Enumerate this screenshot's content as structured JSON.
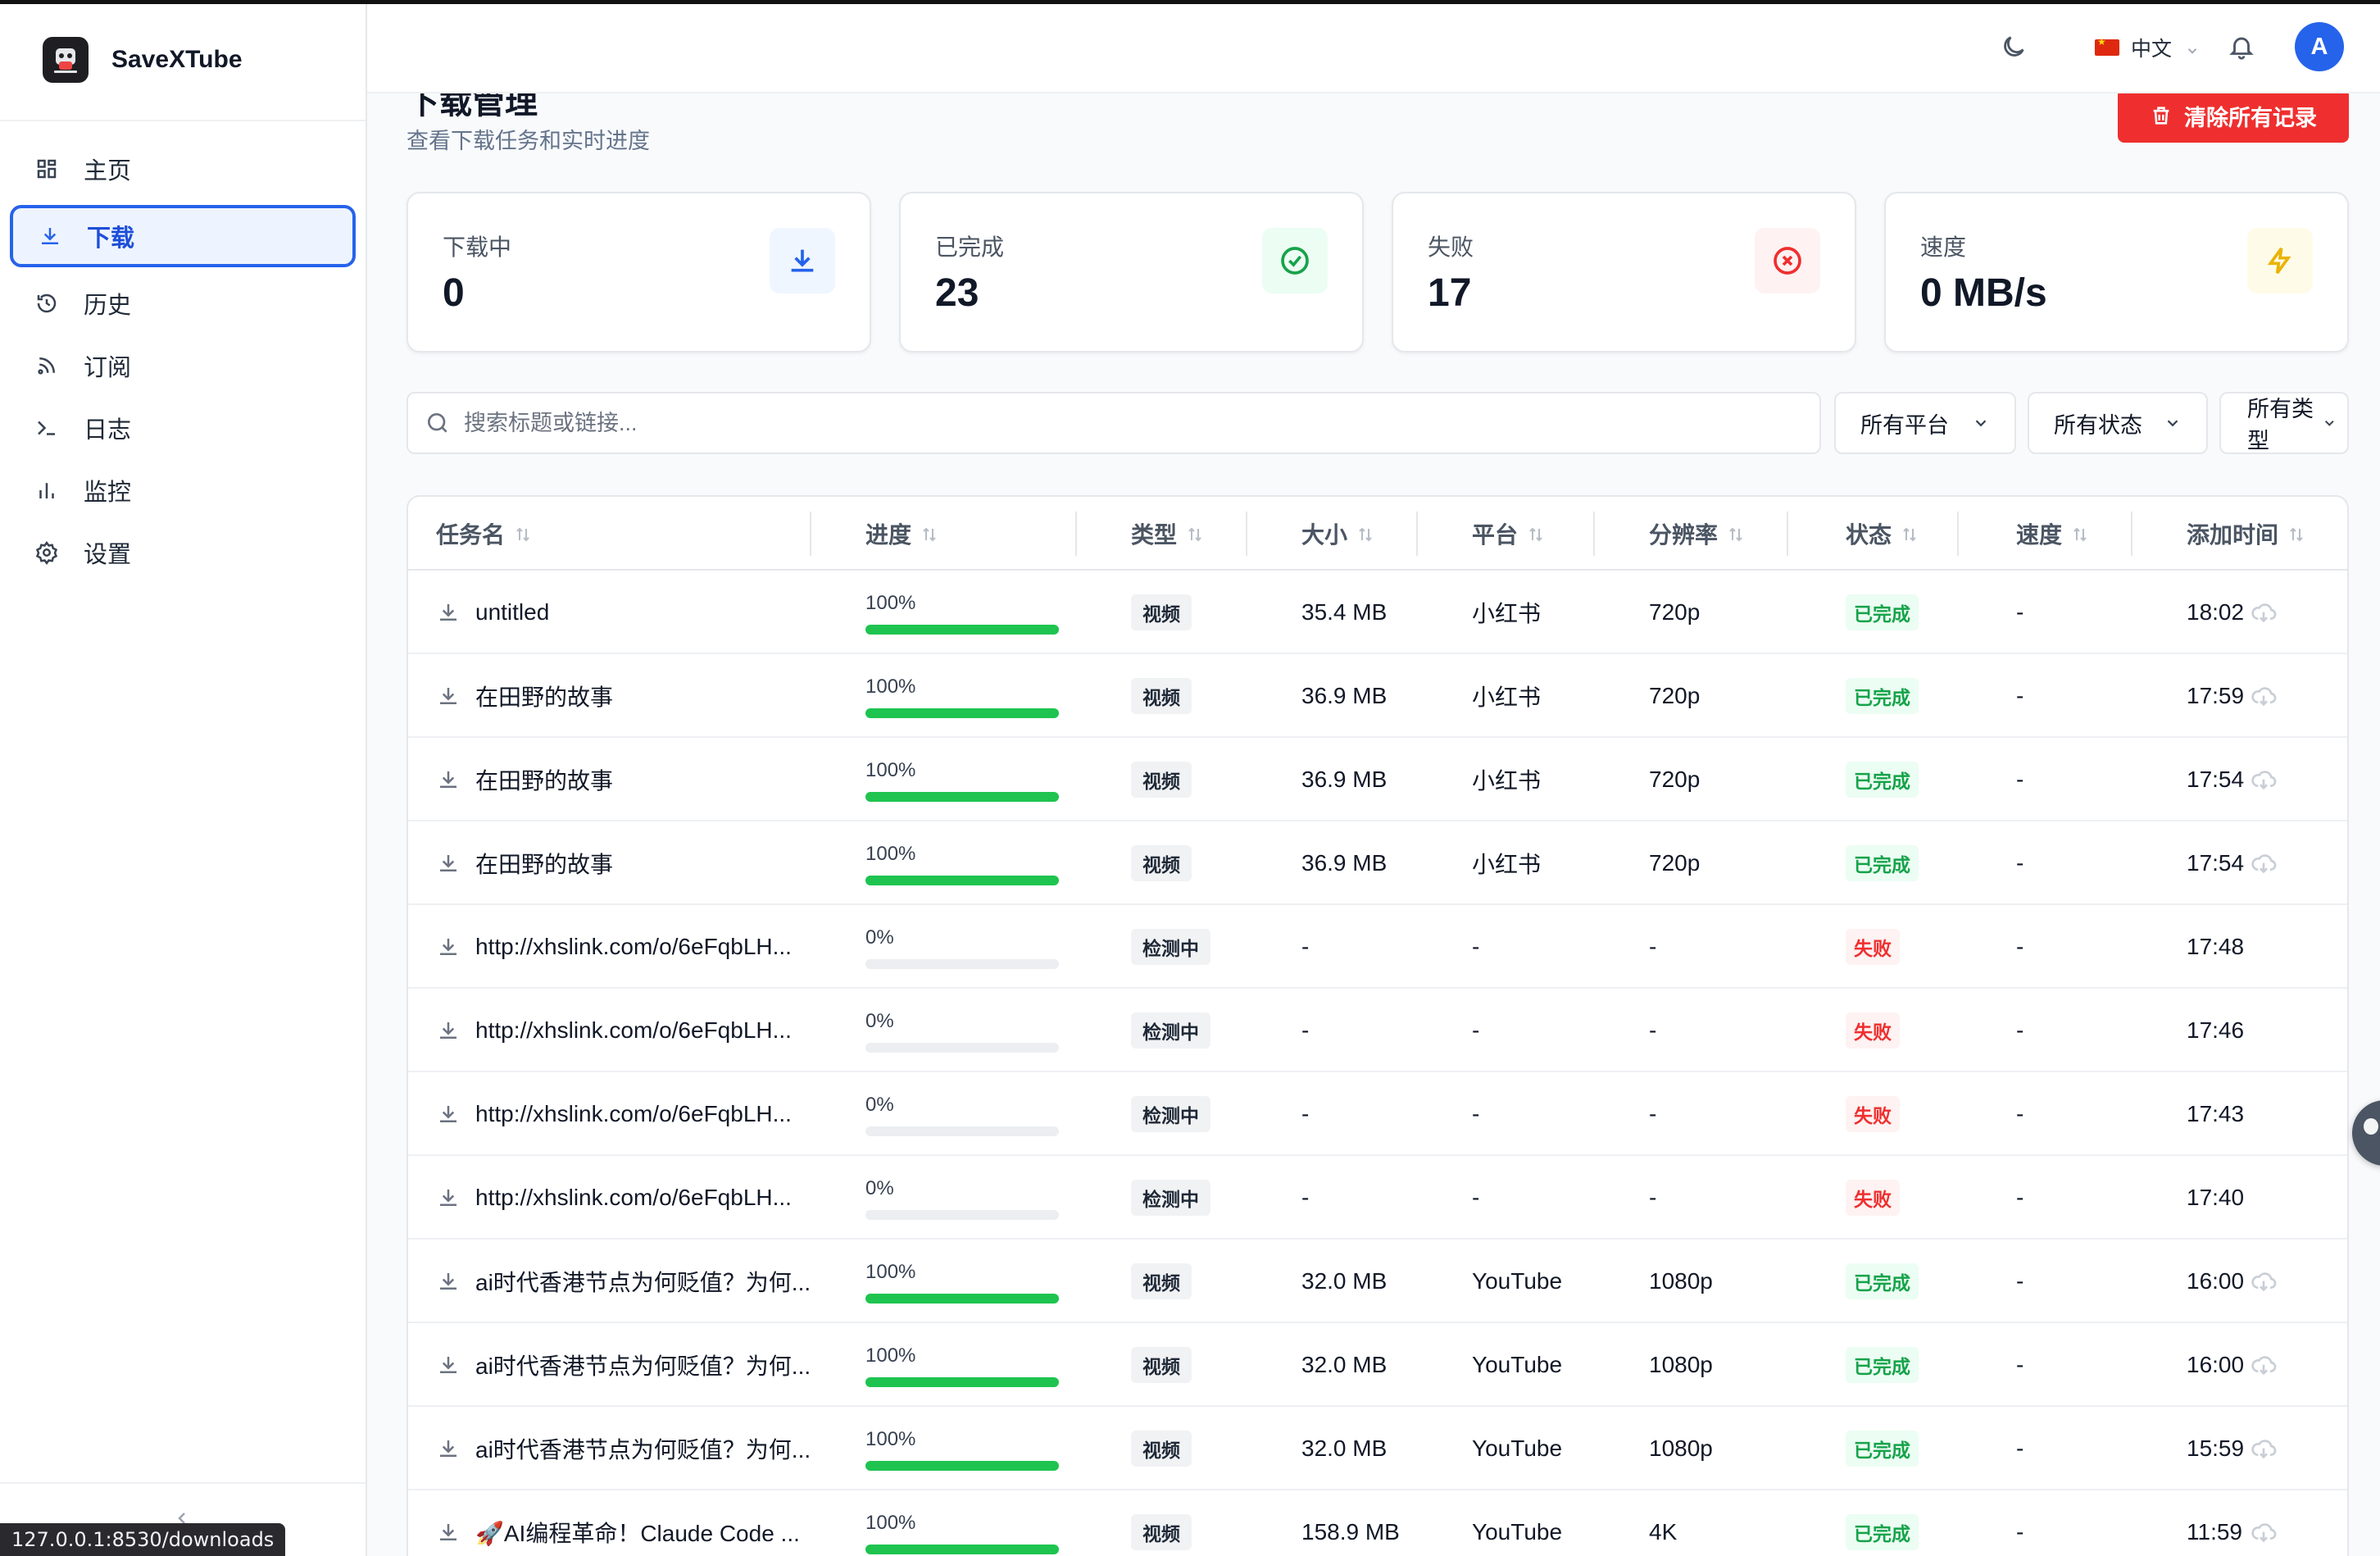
{
  "app": {
    "name": "SaveXTube",
    "status_url": "127.0.0.1:8530/downloads"
  },
  "sidebar": {
    "items": [
      {
        "label": "主页",
        "icon": "dashboard-icon"
      },
      {
        "label": "下载",
        "icon": "download-icon",
        "active": true
      },
      {
        "label": "历史",
        "icon": "history-icon"
      },
      {
        "label": "订阅",
        "icon": "rss-icon"
      },
      {
        "label": "日志",
        "icon": "terminal-icon"
      },
      {
        "label": "监控",
        "icon": "bar-chart-icon"
      },
      {
        "label": "设置",
        "icon": "gear-icon"
      }
    ]
  },
  "header": {
    "language": "中文",
    "avatar_initial": "A"
  },
  "page": {
    "title": "下载管理",
    "subtitle": "查看下载任务和实时进度",
    "clear_button": "清除所有记录"
  },
  "stats": [
    {
      "label": "下载中",
      "value": "0",
      "icon": "download-icon",
      "color": "#2563eb",
      "bg": "#eff6ff"
    },
    {
      "label": "已完成",
      "value": "23",
      "icon": "check-circle-icon",
      "color": "#16a34a",
      "bg": "#ecfdf3"
    },
    {
      "label": "失败",
      "value": "17",
      "icon": "x-circle-icon",
      "color": "#ef2f2f",
      "bg": "#fef2f2"
    },
    {
      "label": "速度",
      "value": "0 MB/s",
      "icon": "lightning-icon",
      "color": "#eab308",
      "bg": "#fefce8"
    }
  ],
  "search": {
    "placeholder": "搜索标题或链接..."
  },
  "filters": {
    "platform": "所有平台",
    "status": "所有状态",
    "type": "所有类型"
  },
  "table": {
    "columns": [
      "任务名",
      "进度",
      "类型",
      "大小",
      "平台",
      "分辨率",
      "状态",
      "速度",
      "添加时间"
    ],
    "rows": [
      {
        "name": "untitled",
        "progress": 100,
        "progress_label": "100%",
        "type": "视频",
        "size": "35.4 MB",
        "platform": "小红书",
        "resolution": "720p",
        "status": "已完成",
        "status_kind": "ok",
        "speed": "-",
        "added": "18:02"
      },
      {
        "name": "在田野的故事",
        "progress": 100,
        "progress_label": "100%",
        "type": "视频",
        "size": "36.9 MB",
        "platform": "小红书",
        "resolution": "720p",
        "status": "已完成",
        "status_kind": "ok",
        "speed": "-",
        "added": "17:59"
      },
      {
        "name": "在田野的故事",
        "progress": 100,
        "progress_label": "100%",
        "type": "视频",
        "size": "36.9 MB",
        "platform": "小红书",
        "resolution": "720p",
        "status": "已完成",
        "status_kind": "ok",
        "speed": "-",
        "added": "17:54"
      },
      {
        "name": "在田野的故事",
        "progress": 100,
        "progress_label": "100%",
        "type": "视频",
        "size": "36.9 MB",
        "platform": "小红书",
        "resolution": "720p",
        "status": "已完成",
        "status_kind": "ok",
        "speed": "-",
        "added": "17:54"
      },
      {
        "name": "http://xhslink.com/o/6eFqbLH...",
        "progress": 0,
        "progress_label": "0%",
        "type": "检测中",
        "size": "-",
        "platform": "-",
        "resolution": "-",
        "status": "失败",
        "status_kind": "fail",
        "speed": "-",
        "added": "17:48"
      },
      {
        "name": "http://xhslink.com/o/6eFqbLH...",
        "progress": 0,
        "progress_label": "0%",
        "type": "检测中",
        "size": "-",
        "platform": "-",
        "resolution": "-",
        "status": "失败",
        "status_kind": "fail",
        "speed": "-",
        "added": "17:46"
      },
      {
        "name": "http://xhslink.com/o/6eFqbLH...",
        "progress": 0,
        "progress_label": "0%",
        "type": "检测中",
        "size": "-",
        "platform": "-",
        "resolution": "-",
        "status": "失败",
        "status_kind": "fail",
        "speed": "-",
        "added": "17:43"
      },
      {
        "name": "http://xhslink.com/o/6eFqbLH...",
        "progress": 0,
        "progress_label": "0%",
        "type": "检测中",
        "size": "-",
        "platform": "-",
        "resolution": "-",
        "status": "失败",
        "status_kind": "fail",
        "speed": "-",
        "added": "17:40"
      },
      {
        "name": "ai时代香港节点为何贬值？为何...",
        "progress": 100,
        "progress_label": "100%",
        "type": "视频",
        "size": "32.0 MB",
        "platform": "YouTube",
        "resolution": "1080p",
        "status": "已完成",
        "status_kind": "ok",
        "speed": "-",
        "added": "16:00"
      },
      {
        "name": "ai时代香港节点为何贬值？为何...",
        "progress": 100,
        "progress_label": "100%",
        "type": "视频",
        "size": "32.0 MB",
        "platform": "YouTube",
        "resolution": "1080p",
        "status": "已完成",
        "status_kind": "ok",
        "speed": "-",
        "added": "16:00"
      },
      {
        "name": "ai时代香港节点为何贬值？为何...",
        "progress": 100,
        "progress_label": "100%",
        "type": "视频",
        "size": "32.0 MB",
        "platform": "YouTube",
        "resolution": "1080p",
        "status": "已完成",
        "status_kind": "ok",
        "speed": "-",
        "added": "15:59"
      },
      {
        "name": "🚀AI编程革命！Claude Code ...",
        "progress": 100,
        "progress_label": "100%",
        "type": "视频",
        "size": "158.9 MB",
        "platform": "YouTube",
        "resolution": "4K",
        "status": "已完成",
        "status_kind": "ok",
        "speed": "-",
        "added": "11:59"
      }
    ]
  }
}
